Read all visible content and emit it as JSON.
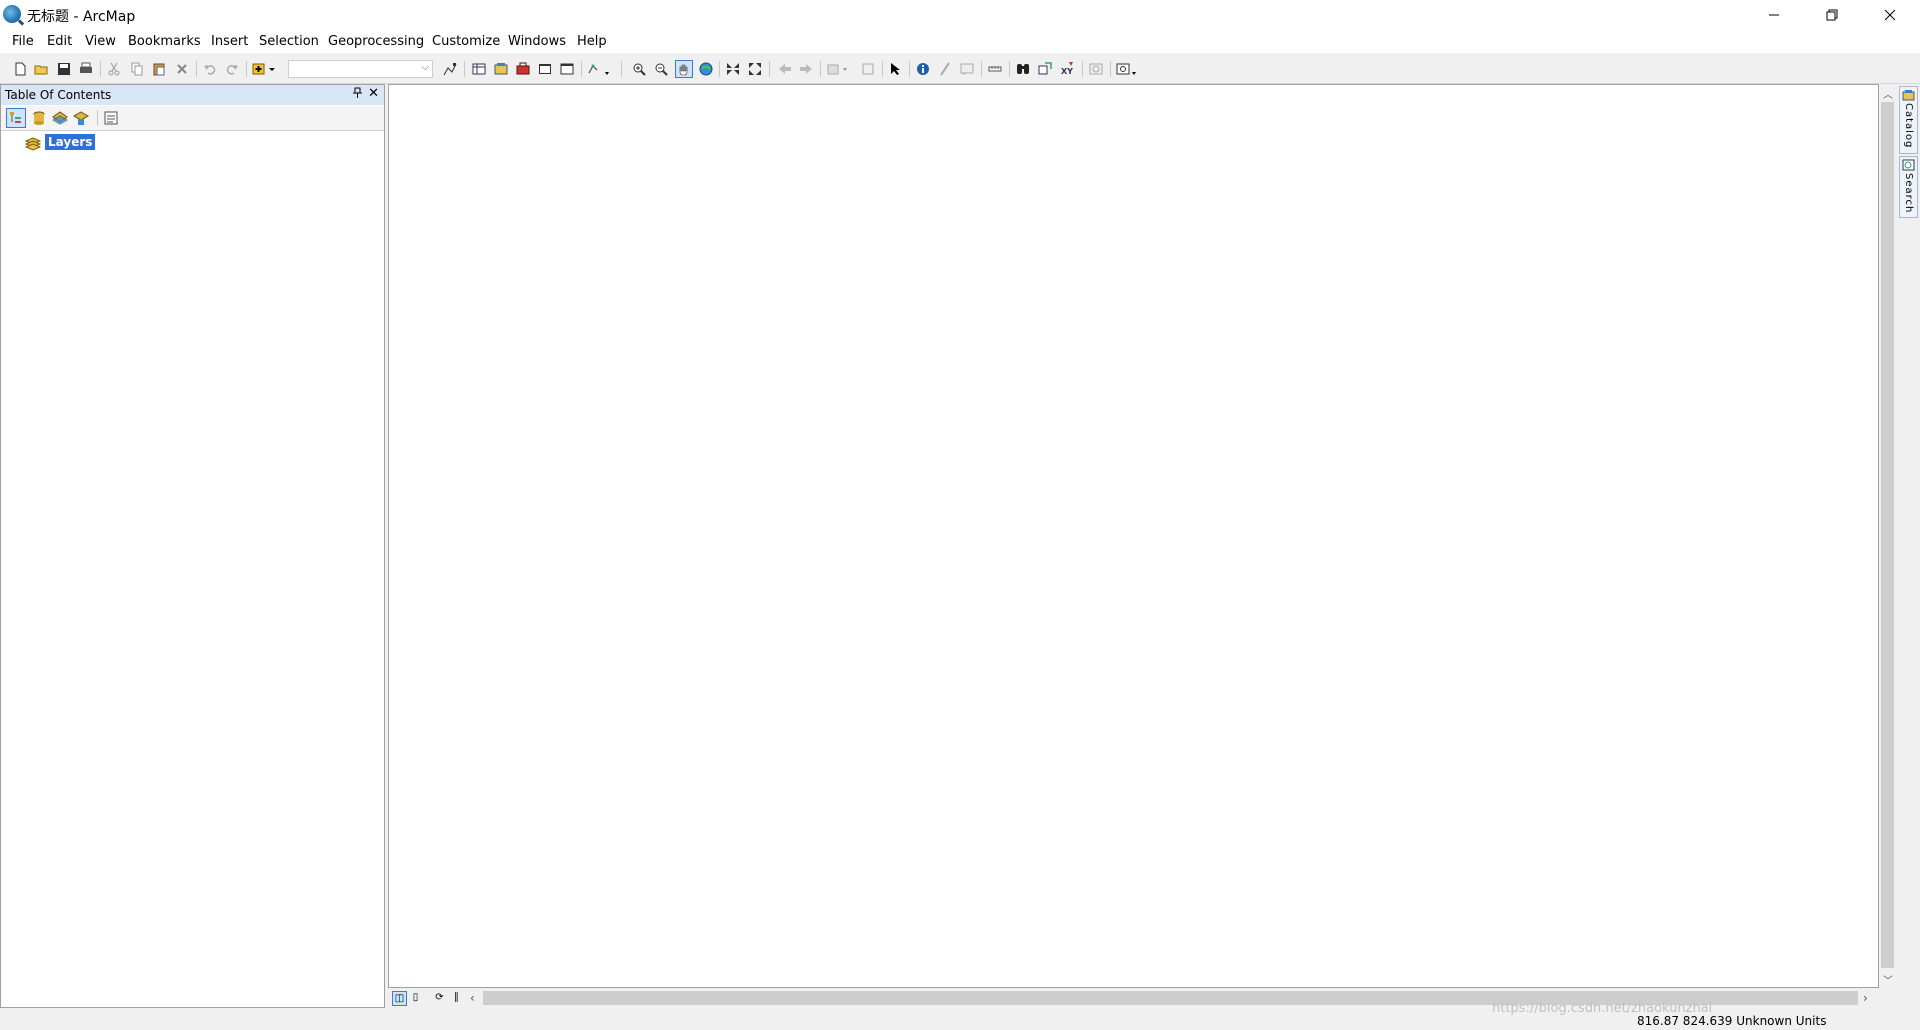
{
  "window": {
    "title": "无标题 - ArcMap",
    "minimize_icon": "minimize-icon",
    "maximize_icon": "restore-icon",
    "close_icon": "close-icon"
  },
  "menu": [
    "File",
    "Edit",
    "View",
    "Bookmarks",
    "Insert",
    "Selection",
    "Geoprocessing",
    "Customize",
    "Windows",
    "Help"
  ],
  "toolbar": {
    "scale_combo_value": "",
    "icons": [
      "new-document-icon",
      "open-icon",
      "save-icon",
      "print-icon",
      "cut-icon",
      "copy-icon",
      "paste-icon",
      "delete-icon",
      "undo-icon",
      "redo-icon",
      "add-data-icon",
      "scale-combo",
      "editor-icon",
      "table-icon",
      "arccatalog-icon",
      "arctoolbox-icon",
      "python-icon",
      "model-icon",
      "zoom-in-icon",
      "zoom-out-icon",
      "pan-icon",
      "full-extent-icon",
      "fixed-zoom-in-icon",
      "fixed-zoom-out-icon",
      "back-extent-icon",
      "forward-extent-icon",
      "select-features-icon",
      "clear-selection-icon",
      "select-elements-icon",
      "identify-icon",
      "hyperlink-icon",
      "html-popup-icon",
      "measure-icon",
      "find-icon",
      "find-route-icon",
      "go-to-xy-icon",
      "time-slider-icon",
      "viewer-icon"
    ]
  },
  "toc": {
    "title": "Table Of Contents",
    "tools": [
      "list-by-drawing-order-icon",
      "list-by-source-icon",
      "list-by-visibility-icon",
      "list-by-selection-icon",
      "options-icon"
    ],
    "layers_label": "Layers"
  },
  "side_tabs": [
    "Catalog",
    "Search"
  ],
  "status": {
    "coordinates": "816.87  824.639 Unknown Units"
  },
  "watermark": "https://blog.csdn.net/zhaokunzhai",
  "colors": {
    "selected_layer_bg": "#2f6fd6",
    "toc_header_bg": "#d9e6f5",
    "frame_bg": "#f0f0f0"
  }
}
